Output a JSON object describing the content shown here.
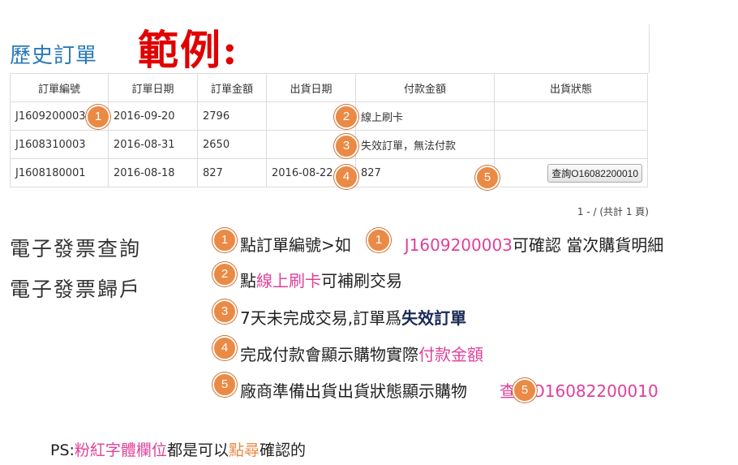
{
  "header": {
    "title": "歷史訂單",
    "example_label": "範例:"
  },
  "table": {
    "columns": [
      "訂單編號",
      "訂單日期",
      "訂單金額",
      "出貨日期",
      "付款金額",
      "出貨狀態"
    ],
    "rows": [
      {
        "order_no": "J1609200003",
        "order_date": "2016-09-20",
        "amount": "2796",
        "ship_date": "",
        "payment": "線上刷卡",
        "status": ""
      },
      {
        "order_no": "J1608310003",
        "order_date": "2016-08-31",
        "amount": "2650",
        "ship_date": "",
        "payment": "失效訂單，無法付款",
        "status": ""
      },
      {
        "order_no": "J1608180001",
        "order_date": "2016-08-18",
        "amount": "827",
        "ship_date": "2016-08-22",
        "payment": "827",
        "status": "查詢O16082200010"
      }
    ],
    "pager": "1 - / (共計 1 頁)"
  },
  "markers": {
    "m1": "1",
    "m2": "2",
    "m3": "3",
    "m4": "4",
    "m5": "5"
  },
  "side_menu": {
    "item1": "電子發票查詢",
    "item2": "電子發票歸戶"
  },
  "instructions": {
    "line1": {
      "a": "點訂單編號>如",
      "b": "J1609200003",
      "c": "可確認 當次購貨明細"
    },
    "line2": {
      "a": "點",
      "b": "線上刷卡",
      "c": "可補刷交易"
    },
    "line3": {
      "a": "7天未完成交易,訂單爲",
      "b": "失效訂單"
    },
    "line4": {
      "a": "完成付款會顯示購物實際",
      "b": "付款金額"
    },
    "line5": {
      "a": "廠商準備出貨出貨狀態顯示購物",
      "b": "查詢O16082200010"
    }
  },
  "footer": {
    "a": "PS:",
    "b": "粉紅字體欄位",
    "c": "都是可以",
    "d": "點尋",
    "e": "確認的"
  },
  "colors": {
    "accent_blue": "#2a7ab8",
    "example_red": "#e00000",
    "marker_orange": "#ea8a45",
    "pink": "#e0409a"
  }
}
